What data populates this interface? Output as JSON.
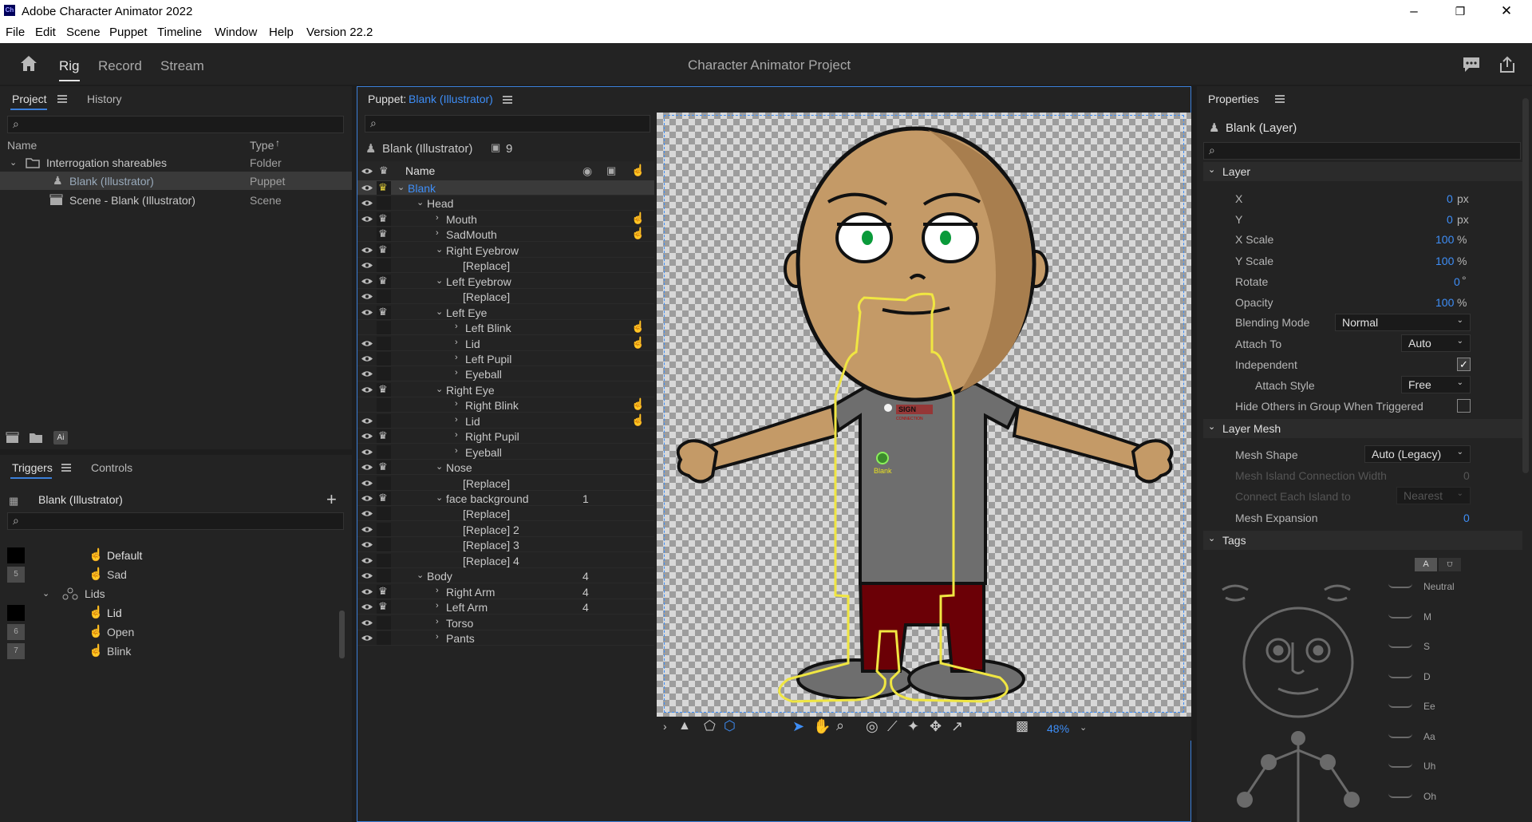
{
  "window": {
    "title": "Adobe Character Animator 2022",
    "app_icon": "Ch"
  },
  "menu": [
    "File",
    "Edit",
    "Scene",
    "Puppet",
    "Timeline",
    "Window",
    "Help",
    "Version 22.2"
  ],
  "modes": {
    "rig": "Rig",
    "record": "Record",
    "stream": "Stream",
    "project_title": "Character Animator Project"
  },
  "project": {
    "tabs": [
      "Project",
      "History"
    ],
    "col_name": "Name",
    "col_type": "Type",
    "items": [
      {
        "name": "Interrogation shareables",
        "type": "Folder"
      },
      {
        "name": "Blank (Illustrator)",
        "type": "Puppet"
      },
      {
        "name": "Scene - Blank (Illustrator)",
        "type": "Scene"
      }
    ],
    "ai_badge": "Ai"
  },
  "triggers": {
    "tabs": [
      "Triggers",
      "Controls"
    ],
    "puppet": "Blank (Illustrator)",
    "items": [
      {
        "key": "",
        "label": "Default"
      },
      {
        "key": "5",
        "label": "Sad"
      },
      {
        "key": "",
        "label": "Lids"
      },
      {
        "key": "",
        "label": "Lid"
      },
      {
        "key": "6",
        "label": "Open"
      },
      {
        "key": "7",
        "label": "Blink"
      }
    ]
  },
  "puppet_panel": {
    "title_prefix": "Puppet:",
    "title_name": "Blank (Illustrator)",
    "puppet_name": "Blank (Illustrator)",
    "count": "9",
    "col_name": "Name",
    "layers": [
      {
        "label": "Blank",
        "num": ""
      },
      {
        "label": "Head",
        "num": ""
      },
      {
        "label": "Mouth",
        "num": ""
      },
      {
        "label": "SadMouth",
        "num": ""
      },
      {
        "label": "Right Eyebrow",
        "num": ""
      },
      {
        "label": "[Replace]",
        "num": ""
      },
      {
        "label": "Left Eyebrow",
        "num": ""
      },
      {
        "label": "[Replace]",
        "num": ""
      },
      {
        "label": "Left Eye",
        "num": ""
      },
      {
        "label": "Left Blink",
        "num": ""
      },
      {
        "label": "Lid",
        "num": ""
      },
      {
        "label": "Left Pupil",
        "num": ""
      },
      {
        "label": "Eyeball",
        "num": ""
      },
      {
        "label": "Right Eye",
        "num": ""
      },
      {
        "label": "Right Blink",
        "num": ""
      },
      {
        "label": "Lid",
        "num": ""
      },
      {
        "label": "Right Pupil",
        "num": ""
      },
      {
        "label": "Eyeball",
        "num": ""
      },
      {
        "label": "Nose",
        "num": ""
      },
      {
        "label": "[Replace]",
        "num": ""
      },
      {
        "label": "face background",
        "num": "1"
      },
      {
        "label": "[Replace]",
        "num": ""
      },
      {
        "label": "[Replace] 2",
        "num": ""
      },
      {
        "label": "[Replace] 3",
        "num": ""
      },
      {
        "label": "[Replace] 4",
        "num": ""
      },
      {
        "label": "Body",
        "num": "4"
      },
      {
        "label": "Right Arm",
        "num": "4"
      },
      {
        "label": "Left Arm",
        "num": "4"
      },
      {
        "label": "Torso",
        "num": ""
      },
      {
        "label": "Pants",
        "num": ""
      }
    ]
  },
  "canvas": {
    "shirt_text": "SIGN",
    "shirt_subtext": "CONNECTION",
    "handle_label": "Blank",
    "zoom": "48%"
  },
  "properties": {
    "title": "Properties",
    "layer_name": "Blank (Layer)",
    "layer_section": "Layer",
    "x_label": "X",
    "x_val": "0",
    "x_unit": "px",
    "y_label": "Y",
    "y_val": "0",
    "y_unit": "px",
    "xs_label": "X Scale",
    "xs_val": "100",
    "xs_unit": "%",
    "ys_label": "Y Scale",
    "ys_val": "100",
    "ys_unit": "%",
    "rot_label": "Rotate",
    "rot_val": "0",
    "rot_unit": "°",
    "op_label": "Opacity",
    "op_val": "100",
    "op_unit": "%",
    "blend_label": "Blending Mode",
    "blend_val": "Normal",
    "attach_label": "Attach To",
    "attach_val": "Auto",
    "indep_label": "Independent",
    "style_label": "Attach Style",
    "style_val": "Free",
    "hide_label": "Hide Others in Group When Triggered",
    "mesh_section": "Layer Mesh",
    "mesh_shape_label": "Mesh Shape",
    "mesh_shape_val": "Auto (Legacy)",
    "island_label": "Mesh Island Connection Width",
    "island_val": "0",
    "connect_label": "Connect Each Island to",
    "connect_val": "Nearest",
    "expansion_label": "Mesh Expansion",
    "expansion_val": "0",
    "tags_section": "Tags",
    "tag_toggle": "A",
    "visemes": [
      "Neutral",
      "M",
      "S",
      "D",
      "Ee",
      "Aa",
      "Uh",
      "Oh"
    ]
  },
  "colors": {
    "accent": "#3e8ef7",
    "selection": "#3a3a3a",
    "yellow": "#f0e642"
  }
}
